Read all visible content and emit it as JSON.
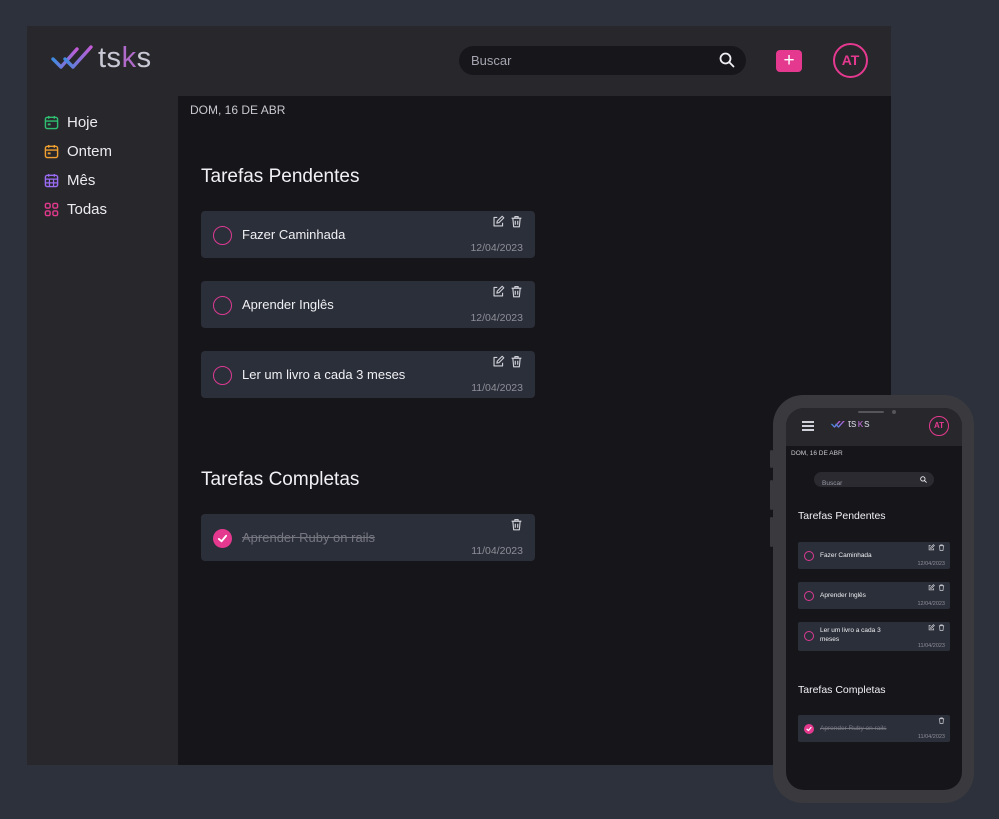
{
  "app": {
    "logo": {
      "prefix": "ts",
      "k": "k",
      "suffix": "s"
    },
    "search_placeholder": "Buscar",
    "add_label": "+",
    "avatar": "AT"
  },
  "sidebar": {
    "items": [
      {
        "label": "Hoje",
        "icon": "calendar-icon",
        "color": "#2fbf71"
      },
      {
        "label": "Ontem",
        "icon": "calendar-icon",
        "color": "#f0a030"
      },
      {
        "label": "Mês",
        "icon": "calendar-grid-icon",
        "color": "#9b6cf5"
      },
      {
        "label": "Todas",
        "icon": "grid-icon",
        "color": "#e5398f"
      }
    ]
  },
  "main": {
    "date": "DOM, 16 DE ABR",
    "pending_title": "Tarefas Pendentes",
    "completed_title": "Tarefas Completas",
    "pending": [
      {
        "title": "Fazer Caminhada",
        "date": "12/04/2023"
      },
      {
        "title": "Aprender Inglês",
        "date": "12/04/2023"
      },
      {
        "title": "Ler um livro a cada 3 meses",
        "date": "11/04/2023"
      }
    ],
    "completed": [
      {
        "title": "Aprender Ruby on rails",
        "date": "11/04/2023"
      }
    ]
  },
  "phone": {
    "logo": {
      "prefix": "ts",
      "k": "k",
      "suffix": "s"
    },
    "avatar": "AT",
    "date": "DOM, 16 DE ABR",
    "search_placeholder": "Buscar",
    "pending_title": "Tarefas Pendentes",
    "completed_title": "Tarefas Completas",
    "pending": [
      {
        "title": "Fazer Caminhada",
        "date": "12/04/2023"
      },
      {
        "title": "Aprender Inglês",
        "date": "12/04/2023"
      },
      {
        "title": "Ler um livro a cada 3 meses",
        "date": "11/04/2023"
      }
    ],
    "completed": [
      {
        "title": "Aprender Ruby on rails",
        "date": "11/04/2023"
      }
    ]
  },
  "colors": {
    "accent": "#e5398f",
    "background": "#2c313c",
    "panel": "#28282c",
    "content": "#16161a",
    "card": "#2b2f39"
  }
}
